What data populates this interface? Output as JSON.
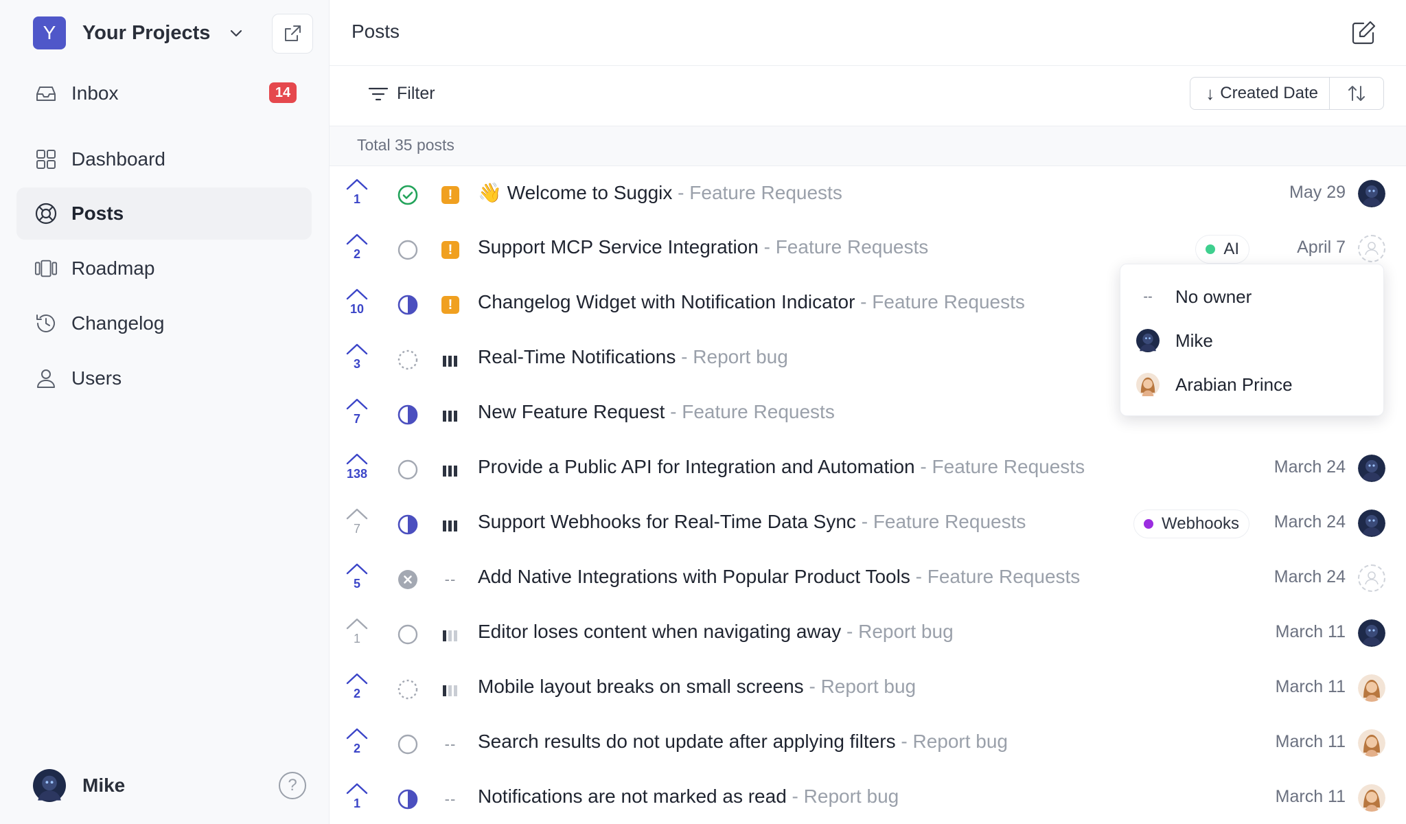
{
  "project": {
    "initial": "Y",
    "name": "Your Projects"
  },
  "nav": [
    {
      "id": "inbox",
      "label": "Inbox",
      "badge": "14"
    },
    {
      "id": "dashboard",
      "label": "Dashboard"
    },
    {
      "id": "posts",
      "label": "Posts",
      "active": true
    },
    {
      "id": "roadmap",
      "label": "Roadmap"
    },
    {
      "id": "changelog",
      "label": "Changelog"
    },
    {
      "id": "users",
      "label": "Users"
    }
  ],
  "user": {
    "name": "Mike"
  },
  "header": {
    "title": "Posts"
  },
  "toolbar": {
    "filter_label": "Filter",
    "sort_label": "Created Date"
  },
  "summary": "Total 35 posts",
  "posts": [
    {
      "votes": "1",
      "status": "done",
      "priority": "urgent",
      "emoji": "👋",
      "title": "Welcome to Suggix",
      "board": "Feature Requests",
      "date": "May 29",
      "owner": "mike"
    },
    {
      "votes": "2",
      "status": "open",
      "priority": "urgent",
      "title": "Support MCP Service Integration",
      "board": "Feature Requests",
      "tag": {
        "label": "AI",
        "color": "#3ecf8e"
      },
      "date": "April 7",
      "owner": "none"
    },
    {
      "votes": "10",
      "status": "in-progress",
      "priority": "urgent",
      "title": "Changelog Widget with Notification Indicator",
      "board": "Feature Requests",
      "date": "",
      "owner": ""
    },
    {
      "votes": "3",
      "status": "planned",
      "priority": "high",
      "title": "Real-Time Notifications",
      "board": "Report bug",
      "date": "",
      "owner": ""
    },
    {
      "votes": "7",
      "status": "in-progress",
      "priority": "high",
      "title": "New Feature Request",
      "board": "Feature Requests",
      "date": "",
      "owner": ""
    },
    {
      "votes": "138",
      "status": "open",
      "priority": "high",
      "title": "Provide a Public API for Integration and Automation",
      "board": "Feature Requests",
      "date": "March 24",
      "owner": "mike"
    },
    {
      "votes": "7",
      "voted": false,
      "status": "in-progress",
      "priority": "high",
      "title": "Support Webhooks for Real-Time Data Sync",
      "board": "Feature Requests",
      "tag": {
        "label": "Webhooks",
        "color": "#9b2de0"
      },
      "date": "March 24",
      "owner": "mike"
    },
    {
      "votes": "5",
      "status": "closed",
      "priority": "none",
      "title": "Add Native Integrations with Popular Product Tools",
      "board": "Feature Requests",
      "date": "March 24",
      "owner": "none"
    },
    {
      "votes": "1",
      "voted": false,
      "status": "open",
      "priority": "low",
      "title": "Editor loses content when navigating away",
      "board": "Report bug",
      "date": "March 11",
      "owner": "mike"
    },
    {
      "votes": "2",
      "status": "planned",
      "priority": "low",
      "title": "Mobile layout breaks on small screens",
      "board": "Report bug",
      "date": "March 11",
      "owner": "arabian"
    },
    {
      "votes": "2",
      "status": "open",
      "priority": "none",
      "title": "Search results do not update after applying filters",
      "board": "Report bug",
      "date": "March 11",
      "owner": "arabian"
    },
    {
      "votes": "1",
      "status": "in-progress",
      "priority": "none",
      "title": "Notifications are not marked as read",
      "board": "Report bug",
      "date": "March 11",
      "owner": "arabian"
    }
  ],
  "owner_dropdown": {
    "options": [
      {
        "label": "No owner",
        "lead": "--"
      },
      {
        "label": "Mike",
        "lead": "mike"
      },
      {
        "label": "Arabian Prince",
        "lead": "arabian"
      }
    ]
  },
  "colors": {
    "accent": "#4f57c9",
    "vote": "#3b45c8",
    "badge": "#e5484d",
    "urgent": "#f0a020"
  }
}
